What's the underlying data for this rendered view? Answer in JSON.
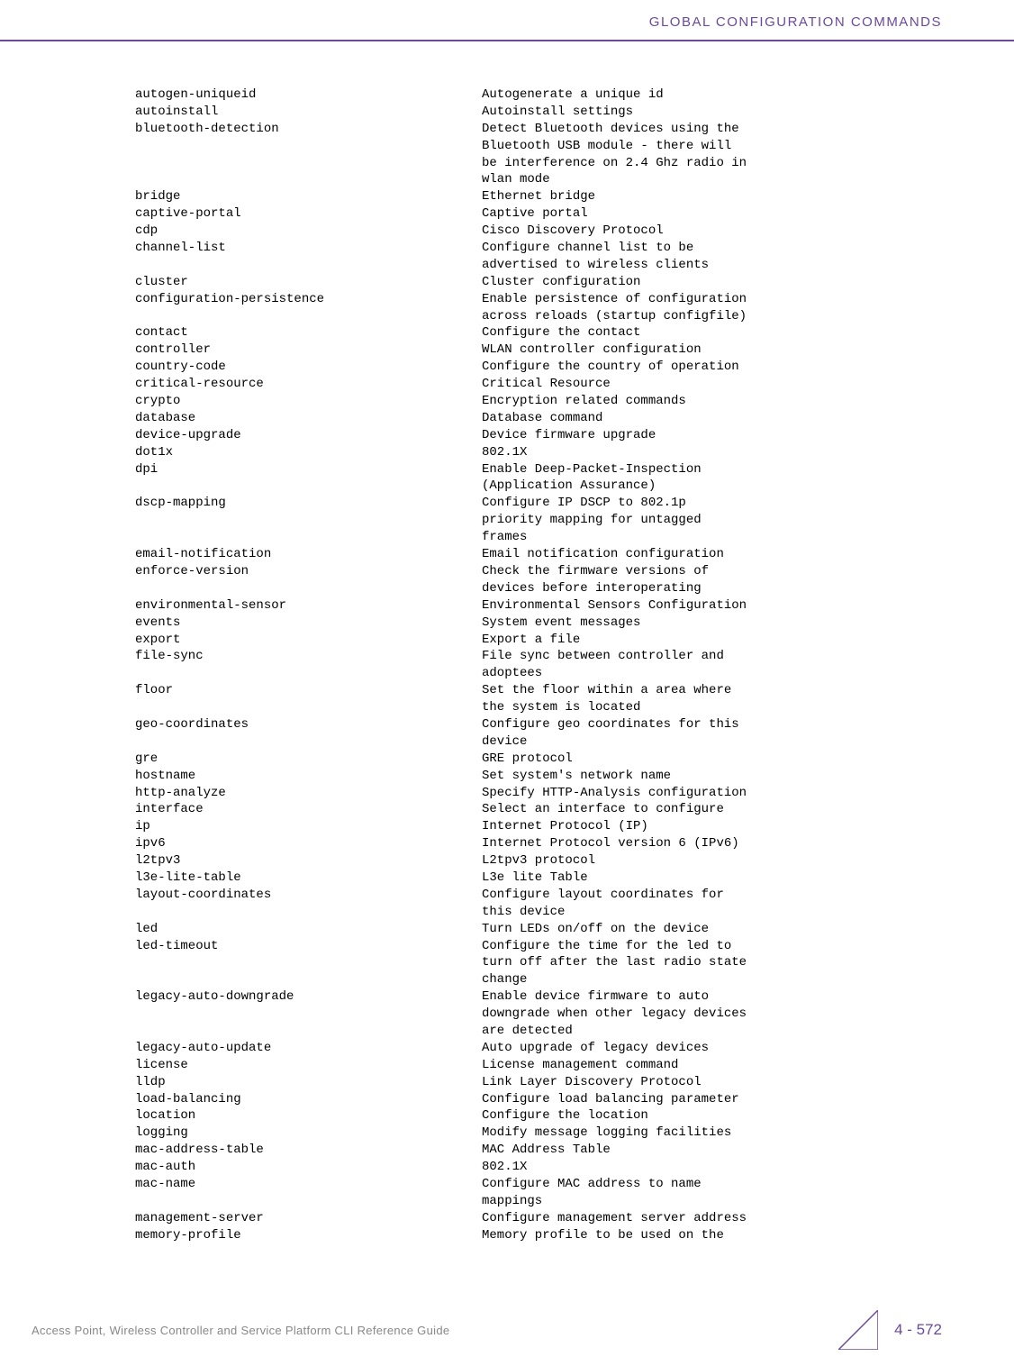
{
  "header": {
    "title": "GLOBAL CONFIGURATION COMMANDS"
  },
  "commands": [
    {
      "name": "autogen-uniqueid",
      "desc": [
        "Autogenerate a unique id"
      ]
    },
    {
      "name": "autoinstall",
      "desc": [
        "Autoinstall settings"
      ]
    },
    {
      "name": "bluetooth-detection",
      "desc": [
        "Detect Bluetooth devices using the",
        "Bluetooth USB module - there will",
        "be interference on 2.4 Ghz radio in",
        "wlan mode"
      ]
    },
    {
      "name": "bridge",
      "desc": [
        "Ethernet bridge"
      ]
    },
    {
      "name": "captive-portal",
      "desc": [
        "Captive portal"
      ]
    },
    {
      "name": "cdp",
      "desc": [
        "Cisco Discovery Protocol"
      ]
    },
    {
      "name": "channel-list",
      "desc": [
        "Configure channel list to be",
        "advertised to wireless clients"
      ]
    },
    {
      "name": "cluster",
      "desc": [
        "Cluster configuration"
      ]
    },
    {
      "name": "configuration-persistence",
      "desc": [
        "Enable persistence of configuration",
        "across reloads (startup configfile)"
      ]
    },
    {
      "name": "contact",
      "desc": [
        "Configure the contact"
      ]
    },
    {
      "name": "controller",
      "desc": [
        "WLAN controller configuration"
      ]
    },
    {
      "name": "country-code",
      "desc": [
        "Configure the country of operation"
      ]
    },
    {
      "name": "critical-resource",
      "desc": [
        "Critical Resource"
      ]
    },
    {
      "name": "crypto",
      "desc": [
        "Encryption related commands"
      ]
    },
    {
      "name": "database",
      "desc": [
        "Database command"
      ]
    },
    {
      "name": "device-upgrade",
      "desc": [
        "Device firmware upgrade"
      ]
    },
    {
      "name": "dot1x",
      "desc": [
        "802.1X"
      ]
    },
    {
      "name": "dpi",
      "desc": [
        "Enable Deep-Packet-Inspection",
        "(Application Assurance)"
      ]
    },
    {
      "name": "dscp-mapping",
      "desc": [
        "Configure IP DSCP to 802.1p",
        "priority mapping for untagged",
        "frames"
      ]
    },
    {
      "name": "email-notification",
      "desc": [
        "Email notification configuration"
      ]
    },
    {
      "name": "enforce-version",
      "desc": [
        "Check the firmware versions of",
        "devices before interoperating"
      ]
    },
    {
      "name": "environmental-sensor",
      "desc": [
        "Environmental Sensors Configuration"
      ]
    },
    {
      "name": "events",
      "desc": [
        "System event messages"
      ]
    },
    {
      "name": "export",
      "desc": [
        "Export a file"
      ]
    },
    {
      "name": "file-sync",
      "desc": [
        "File sync between controller and",
        "adoptees"
      ]
    },
    {
      "name": "floor",
      "desc": [
        "Set the floor within a area where",
        "the system is located"
      ]
    },
    {
      "name": "geo-coordinates",
      "desc": [
        "Configure geo coordinates for this",
        "device"
      ]
    },
    {
      "name": "gre",
      "desc": [
        "GRE protocol"
      ]
    },
    {
      "name": "hostname",
      "desc": [
        "Set system's network name"
      ]
    },
    {
      "name": "http-analyze",
      "desc": [
        "Specify HTTP-Analysis configuration"
      ]
    },
    {
      "name": "interface",
      "desc": [
        "Select an interface to configure"
      ]
    },
    {
      "name": "ip",
      "desc": [
        "Internet Protocol (IP)"
      ]
    },
    {
      "name": "ipv6",
      "desc": [
        "Internet Protocol version 6 (IPv6)"
      ]
    },
    {
      "name": "l2tpv3",
      "desc": [
        "L2tpv3 protocol"
      ]
    },
    {
      "name": "l3e-lite-table",
      "desc": [
        "L3e lite Table"
      ]
    },
    {
      "name": "layout-coordinates",
      "desc": [
        "Configure layout coordinates for",
        "this device"
      ]
    },
    {
      "name": "led",
      "desc": [
        "Turn LEDs on/off on the device"
      ]
    },
    {
      "name": "led-timeout",
      "desc": [
        "Configure the time for the led to",
        "turn off after the last radio state",
        "change"
      ]
    },
    {
      "name": "legacy-auto-downgrade",
      "desc": [
        "Enable device firmware to auto",
        "downgrade when other legacy devices",
        "are detected"
      ]
    },
    {
      "name": "legacy-auto-update",
      "desc": [
        "Auto upgrade of legacy devices"
      ]
    },
    {
      "name": "license",
      "desc": [
        "License management command"
      ]
    },
    {
      "name": "lldp",
      "desc": [
        "Link Layer Discovery Protocol"
      ]
    },
    {
      "name": "load-balancing",
      "desc": [
        "Configure load balancing parameter"
      ]
    },
    {
      "name": "location",
      "desc": [
        "Configure the location"
      ]
    },
    {
      "name": "logging",
      "desc": [
        "Modify message logging facilities"
      ]
    },
    {
      "name": "mac-address-table",
      "desc": [
        "MAC Address Table"
      ]
    },
    {
      "name": "mac-auth",
      "desc": [
        "802.1X"
      ]
    },
    {
      "name": "mac-name",
      "desc": [
        "Configure MAC address to name",
        "mappings"
      ]
    },
    {
      "name": "management-server",
      "desc": [
        "Configure management server address"
      ]
    },
    {
      "name": "memory-profile",
      "desc": [
        "Memory profile to be used on the"
      ]
    }
  ],
  "footer": {
    "text": "Access Point, Wireless Controller and Service Platform CLI Reference Guide",
    "page": "4 - 572"
  }
}
